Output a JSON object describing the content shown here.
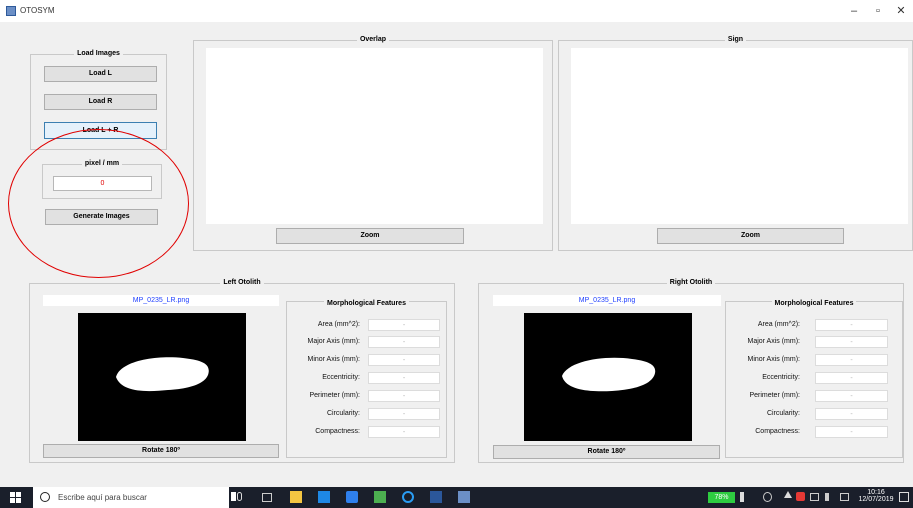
{
  "window": {
    "title": "OTOSYM",
    "minimize": "–",
    "maximize": "▫",
    "close": "✕"
  },
  "load_panel": {
    "title": "Load Images",
    "load_l": "Load L",
    "load_r": "Load R",
    "load_lr": "Load L + R"
  },
  "pixel_panel": {
    "title": "pixel / mm",
    "value": "0"
  },
  "generate_button": "Generate Images",
  "overlap_panel": {
    "title": "Overlap",
    "zoom": "Zoom"
  },
  "sign_panel": {
    "title": "Sign",
    "zoom": "Zoom"
  },
  "left_otolith": {
    "title": "Left Otolith",
    "filename": "MP_0235_LR.png",
    "rotate": "Rotate 180º",
    "features_title": "Morphological Features",
    "features": [
      {
        "label": "Area (mm^2):",
        "value": "-"
      },
      {
        "label": "Major Axis (mm):",
        "value": "-"
      },
      {
        "label": "Minor Axis (mm):",
        "value": "-"
      },
      {
        "label": "Eccentricity:",
        "value": "-"
      },
      {
        "label": "Perimeter (mm):",
        "value": "-"
      },
      {
        "label": "Circularity:",
        "value": "-"
      },
      {
        "label": "Compactness:",
        "value": "-"
      }
    ]
  },
  "right_otolith": {
    "title": "Right Otolith",
    "filename": "MP_0235_LR.png",
    "rotate": "Rotate 180º",
    "features_title": "Morphological Features",
    "features": [
      {
        "label": "Area (mm^2):",
        "value": "-"
      },
      {
        "label": "Major Axis (mm):",
        "value": "-"
      },
      {
        "label": "Minor Axis (mm):",
        "value": "-"
      },
      {
        "label": "Eccentricity:",
        "value": "-"
      },
      {
        "label": "Perimeter (mm):",
        "value": "-"
      },
      {
        "label": "Circularity:",
        "value": "-"
      },
      {
        "label": "Compactness:",
        "value": "-"
      }
    ]
  },
  "taskbar": {
    "search_placeholder": "Escribe aquí para buscar",
    "battery": "78%",
    "time": "10:16",
    "date": "12/07/2019"
  },
  "colors": {
    "annotation_circle": "#e00000",
    "filename_text": "#1f3fff",
    "pixel_value": "#e00000"
  }
}
